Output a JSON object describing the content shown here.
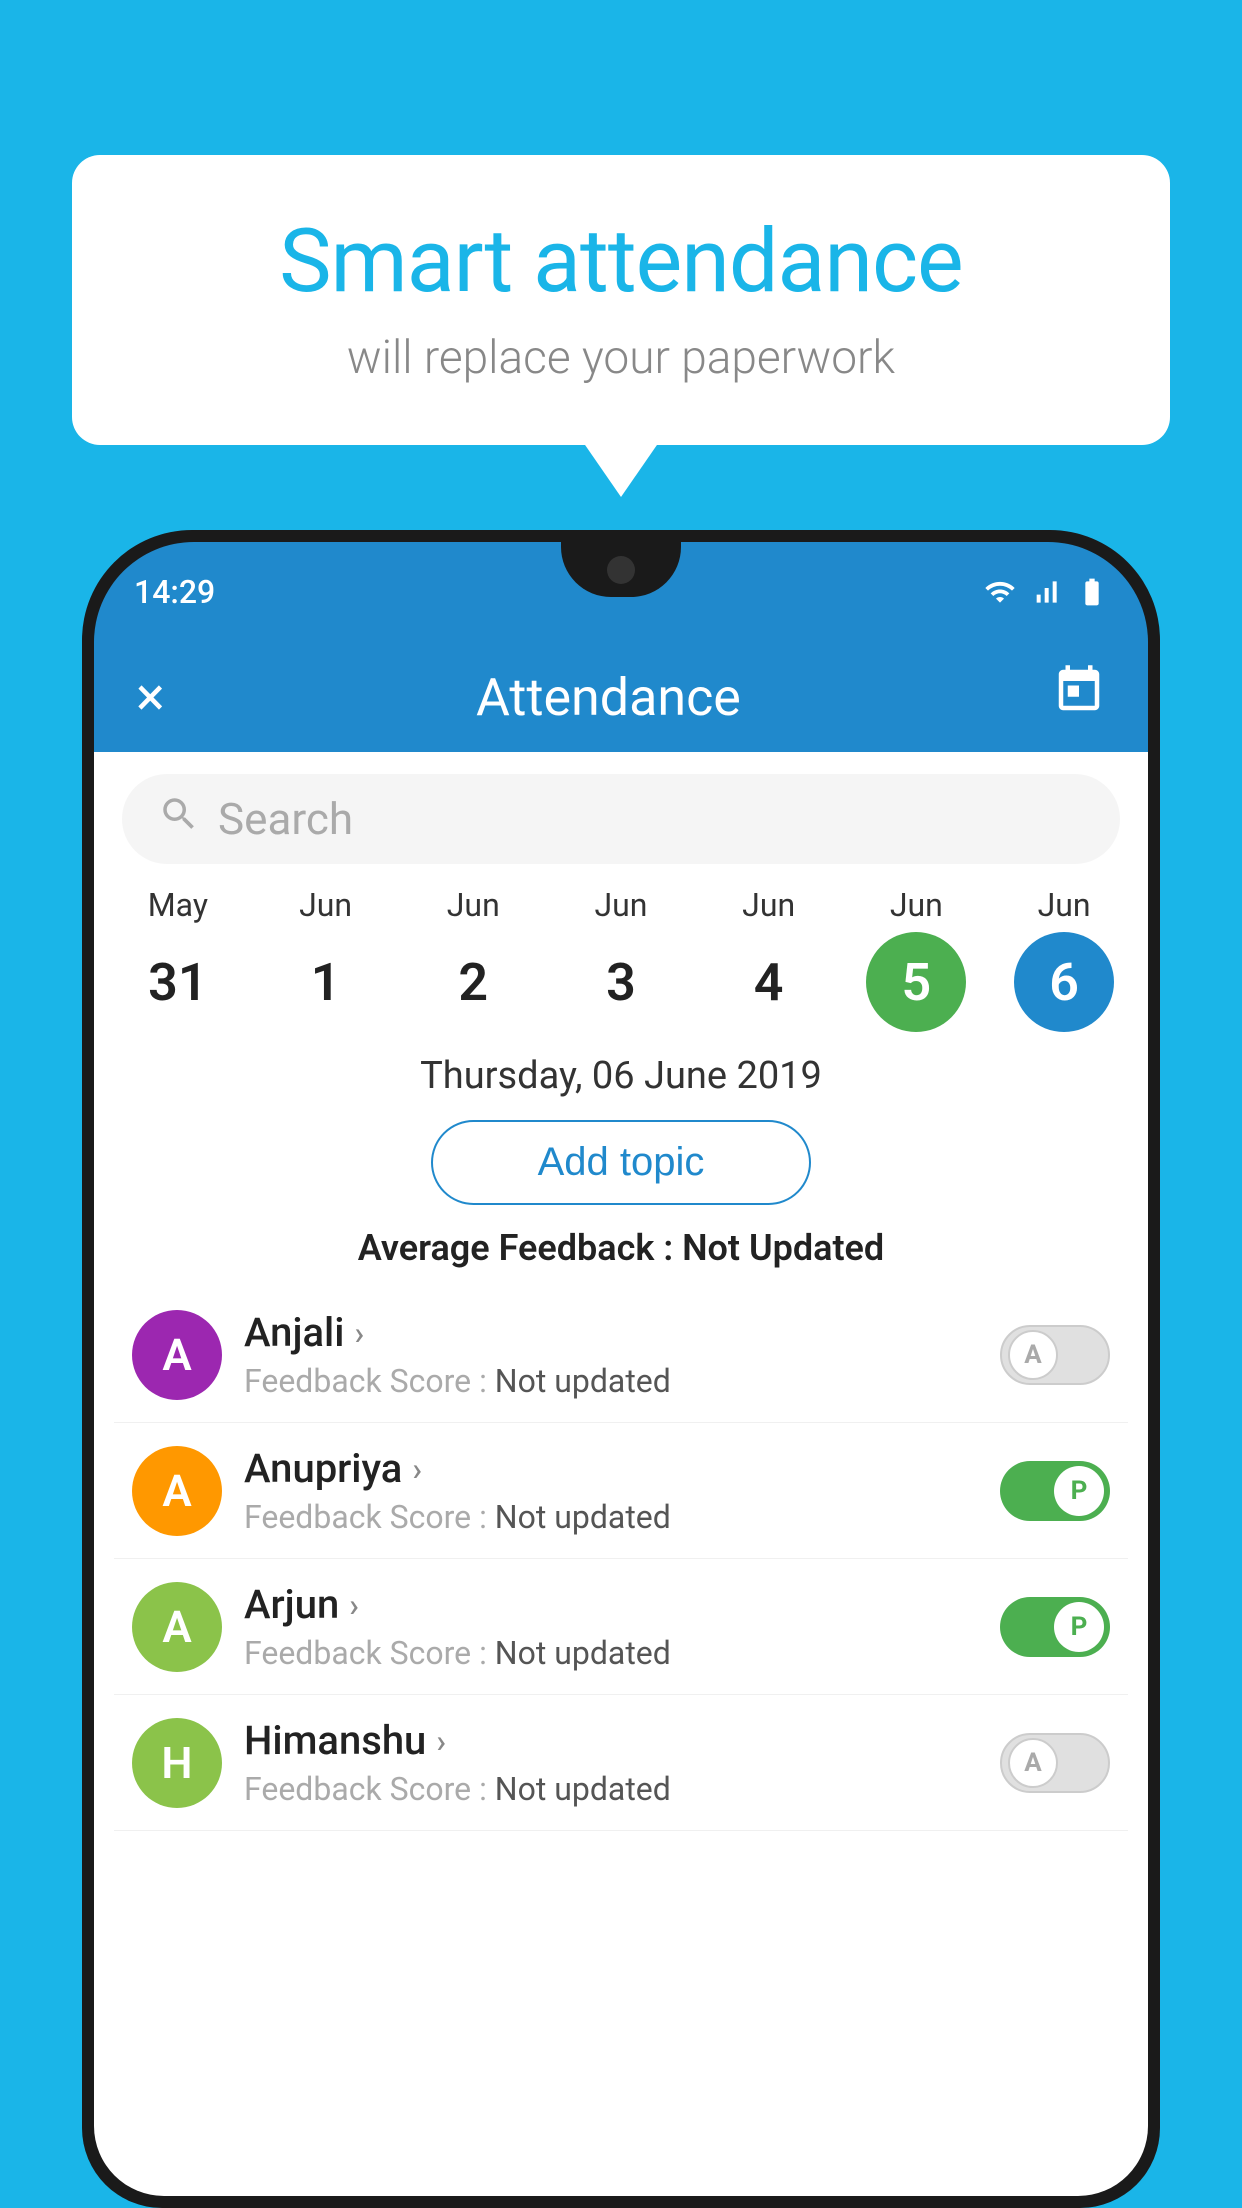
{
  "background_color": "#1ab5e8",
  "speech_bubble": {
    "title": "Smart attendance",
    "subtitle": "will replace your paperwork"
  },
  "status_bar": {
    "time": "14:29"
  },
  "app_bar": {
    "title": "Attendance",
    "close_label": "×",
    "calendar_label": "📅"
  },
  "search": {
    "placeholder": "Search"
  },
  "calendar": {
    "days": [
      {
        "month": "May",
        "day": "31",
        "state": "normal"
      },
      {
        "month": "Jun",
        "day": "1",
        "state": "normal"
      },
      {
        "month": "Jun",
        "day": "2",
        "state": "normal"
      },
      {
        "month": "Jun",
        "day": "3",
        "state": "normal"
      },
      {
        "month": "Jun",
        "day": "4",
        "state": "normal"
      },
      {
        "month": "Jun",
        "day": "5",
        "state": "selected-green"
      },
      {
        "month": "Jun",
        "day": "6",
        "state": "selected-blue"
      }
    ],
    "selected_date": "Thursday, 06 June 2019"
  },
  "add_topic_label": "Add topic",
  "avg_feedback_label": "Average Feedback :",
  "avg_feedback_value": "Not Updated",
  "students": [
    {
      "name": "Anjali",
      "avatar_letter": "A",
      "avatar_color": "purple",
      "feedback_label": "Feedback Score :",
      "feedback_value": "Not updated",
      "toggle_state": "off",
      "toggle_letter": "A"
    },
    {
      "name": "Anupriya",
      "avatar_letter": "A",
      "avatar_color": "orange",
      "feedback_label": "Feedback Score :",
      "feedback_value": "Not updated",
      "toggle_state": "on",
      "toggle_letter": "P"
    },
    {
      "name": "Arjun",
      "avatar_letter": "A",
      "avatar_color": "green",
      "feedback_label": "Feedback Score :",
      "feedback_value": "Not updated",
      "toggle_state": "on",
      "toggle_letter": "P"
    },
    {
      "name": "Himanshu",
      "avatar_letter": "H",
      "avatar_color": "lime",
      "feedback_label": "Feedback Score :",
      "feedback_value": "Not updated",
      "toggle_state": "off",
      "toggle_letter": "A"
    }
  ]
}
